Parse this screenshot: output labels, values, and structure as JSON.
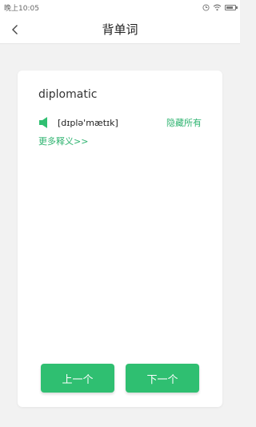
{
  "status_bar": {
    "time": "晚上10:05",
    "icons": [
      "clock-icon",
      "wifi-icon",
      "battery-icon"
    ]
  },
  "header": {
    "title": "背单词",
    "back_icon": "chevron-left-icon"
  },
  "card": {
    "word": "diplomatic",
    "phonetic": "[dɪplə'mætɪk]",
    "speaker_icon": "speaker-icon",
    "hide_all_label": "隐藏所有",
    "more_label": "更多释义>>"
  },
  "buttons": {
    "prev_label": "上一个",
    "next_label": "下一个"
  },
  "colors": {
    "accent": "#2fbf71",
    "link": "#2db36f",
    "background": "#f2f2f2"
  }
}
